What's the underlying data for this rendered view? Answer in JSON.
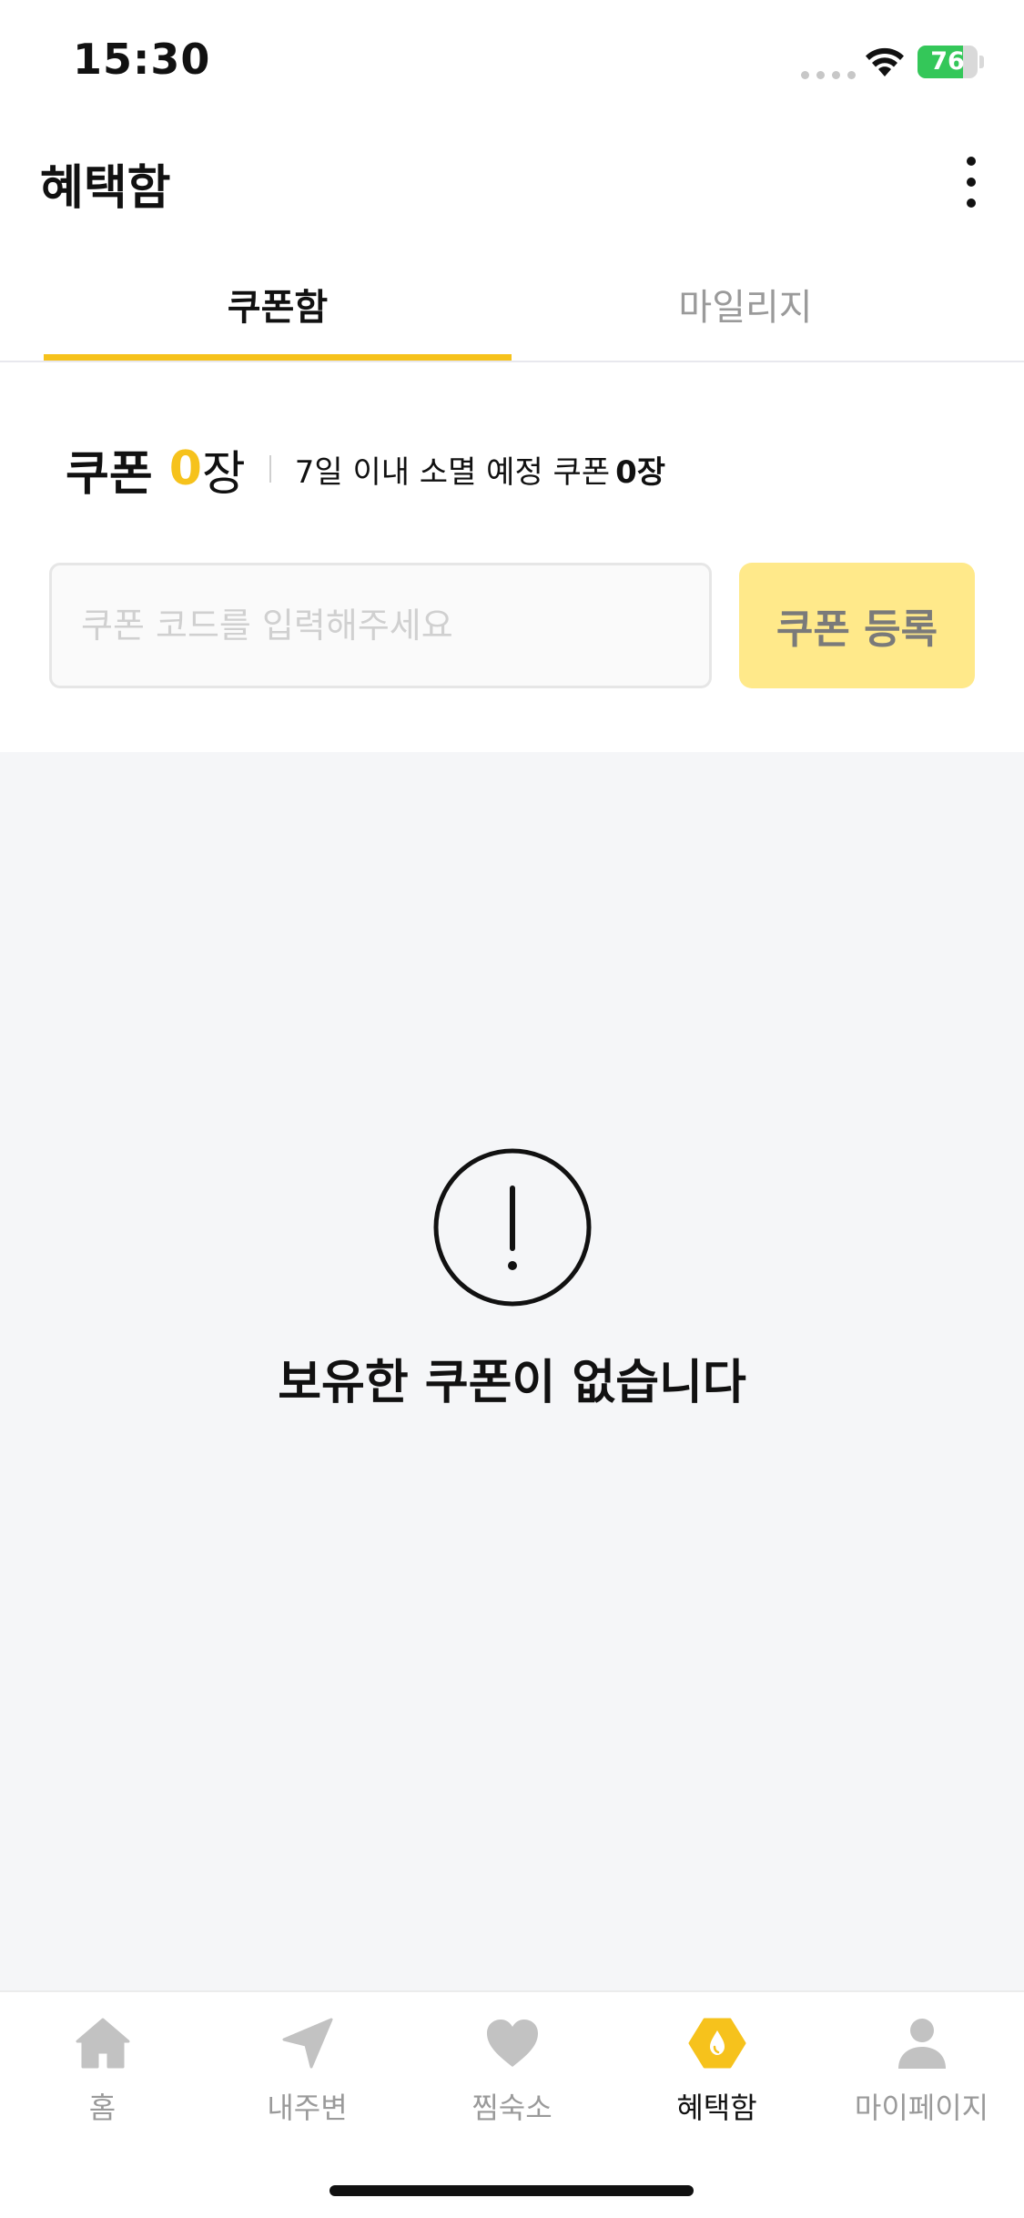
{
  "status_bar": {
    "time": "15:30",
    "battery_level": "76"
  },
  "header": {
    "title": "혜택함",
    "more_icon": "more-vertical-icon"
  },
  "tabs": [
    {
      "label": "쿠폰함",
      "active": true
    },
    {
      "label": "마일리지",
      "active": false
    }
  ],
  "summary": {
    "label": "쿠폰",
    "count": "0",
    "unit": "장",
    "expire_text": "7일 이내 소멸 예정 쿠폰",
    "expire_count": "0장"
  },
  "coupon_form": {
    "placeholder": "쿠폰 코드를 입력해주세요",
    "value": "",
    "register_label": "쿠폰 등록"
  },
  "empty_state": {
    "icon": "exclamation-circle-icon",
    "message": "보유한 쿠폰이 없습니다"
  },
  "bottom_nav": [
    {
      "label": "홈",
      "icon": "home-icon",
      "active": false
    },
    {
      "label": "내주변",
      "icon": "location-arrow-icon",
      "active": false
    },
    {
      "label": "찜숙소",
      "icon": "heart-icon",
      "active": false
    },
    {
      "label": "혜택함",
      "icon": "benefit-hexagon-icon",
      "active": true
    },
    {
      "label": "마이페이지",
      "icon": "person-icon",
      "active": false
    }
  ],
  "colors": {
    "accent": "#f6c21c",
    "register_button_bg": "#ffe98a",
    "content_bg": "#f5f6f8",
    "inactive_text": "#9a9a9a",
    "battery_green": "#34c759"
  }
}
